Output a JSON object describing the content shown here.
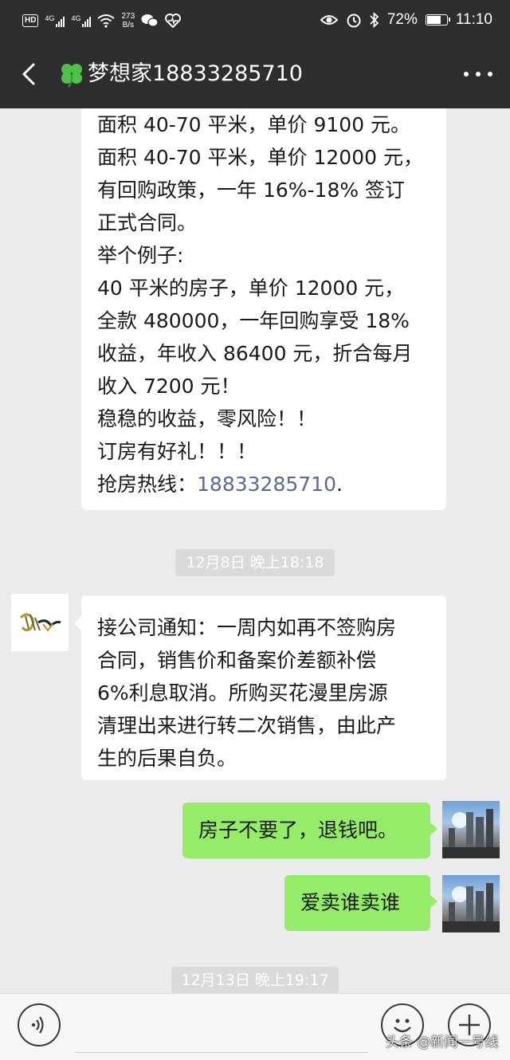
{
  "status_bar": {
    "hd_badge": "HD",
    "signal_1_label": "4G",
    "signal_2_label": "4G",
    "net_speed_value": "273",
    "net_speed_unit": "B/s",
    "battery_percent": "72%",
    "battery_level": 0.72,
    "time": "11:10",
    "icons_left": [
      "hd-icon",
      "signal-icon",
      "signal-icon",
      "wifi-icon",
      "wechat-icon",
      "health-icon"
    ],
    "icons_right": [
      "eye-icon",
      "alarm-icon",
      "bluetooth-icon",
      "battery-icon"
    ]
  },
  "header": {
    "title": "梦想家18833285710",
    "title_icon": "clover-icon",
    "back_icon": "chevron-left-icon",
    "more_icon": "more-dots-icon"
  },
  "colors": {
    "header_bg": "#2e2e2e",
    "chat_bg": "#ebebeb",
    "bubble_incoming": "#ffffff",
    "bubble_outgoing": "#95ec69",
    "link": "#576b95",
    "timestamp_bg": "#dadada"
  },
  "messages": {
    "ad": {
      "lines": [
        "面积 40-70 平米，单价 9100 元。",
        "面积 40-70 平米，单价 12000 元，",
        "有回购政策，一年 16%-18% 签订",
        "正式合同。",
        "举个例子:",
        "40 平米的房子，单价 12000 元，",
        "全款 480000，一年回购享受 18%",
        "收益，年收入 86400 元，折合每月",
        "收入 7200 元！",
        "稳稳的收益，零风险！！",
        "订房有好礼！！！"
      ],
      "hotline_label": "抢房热线：",
      "hotline_number": "18833285710",
      "hotline_suffix": "."
    },
    "timestamp_1": "12月8日 晚上18:18",
    "notice": {
      "lines": [
        "接公司通知：一周内如再不签购房",
        "合同，销售价和备案价差额补偿",
        "6%利息取消。所购买花漫里房源",
        "清理出来进行转二次销售，由此产",
        "生的后果自负。"
      ]
    },
    "reply_1": "房子不要了，退钱吧。",
    "reply_2": "爱卖谁卖谁",
    "timestamp_2": "12月13日 晚上19:17"
  },
  "input_bar": {
    "voice_icon": "voice-icon",
    "emoji_icon": "emoji-icon",
    "plus_icon": "plus-icon",
    "input_value": ""
  },
  "watermark": "头条 @新闻一号线"
}
